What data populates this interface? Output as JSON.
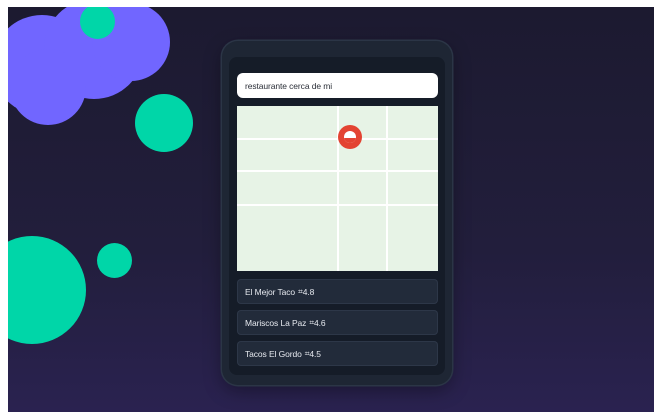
{
  "search": {
    "value": "restaurante cerca de mi"
  },
  "map": {
    "pin_icon": "location-pin-icon",
    "pin_color": "#e34332",
    "land_color": "#e7f3e6"
  },
  "results": [
    {
      "name": "El Mejor Taco",
      "rating_marker": "⌗",
      "rating": "4.8"
    },
    {
      "name": "Mariscos La Paz",
      "rating_marker": "⌗",
      "rating": "4.6"
    },
    {
      "name": "Tacos El Gordo",
      "rating_marker": "⌗",
      "rating": "4.5"
    }
  ],
  "colors": {
    "blob_purple": "#7166ff",
    "blob_teal": "#00d6a8",
    "phone": "#1e2634",
    "background": "#221e3c"
  }
}
